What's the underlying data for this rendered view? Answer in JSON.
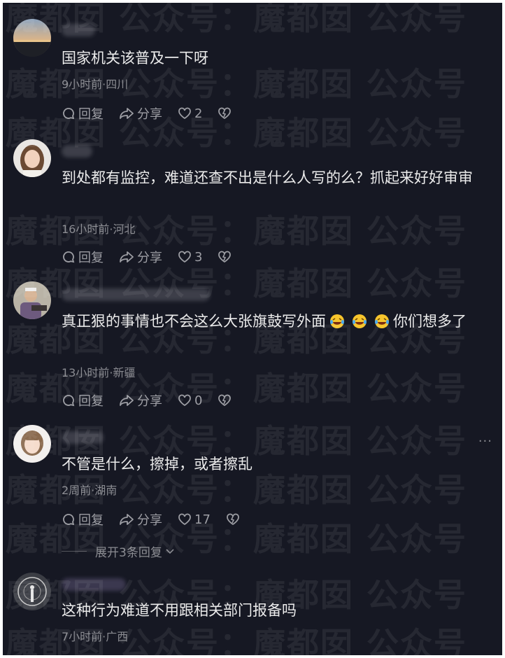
{
  "watermark": {
    "text": "魔都囡  公众号：魔都囡  公众号"
  },
  "comments": [
    {
      "text": "国家机关该普及一下呀",
      "meta": "9小时前·四川",
      "reply_label": "回复",
      "share_label": "分享",
      "likes": "2"
    },
    {
      "text": "到处都有监控，难道还查不出是什么人写的么？抓起来好好审审",
      "meta": "16小时前·河北",
      "reply_label": "回复",
      "share_label": "分享",
      "likes": "3"
    },
    {
      "text_before": "真正狠的事情也不会这么大张旗鼓写外面",
      "text_after": "你们想多了",
      "emoji": "laughing-crying-emoji",
      "meta": "13小时前·新疆",
      "reply_label": "回复",
      "share_label": "分享",
      "likes": "0"
    },
    {
      "text": "不管是什么，擦掉，或者擦乱",
      "meta": "2周前·湖南",
      "reply_label": "回复",
      "share_label": "分享",
      "likes": "17",
      "more": "···",
      "expand_label": "展开3条回复"
    },
    {
      "text": "这种行为难道不用跟相关部门报备吗",
      "meta": "7小时前·广西"
    }
  ],
  "colors": {
    "background": "#161823",
    "text": "#ebebeb",
    "meta": "#8a8b91",
    "action": "#9d9ea4"
  }
}
